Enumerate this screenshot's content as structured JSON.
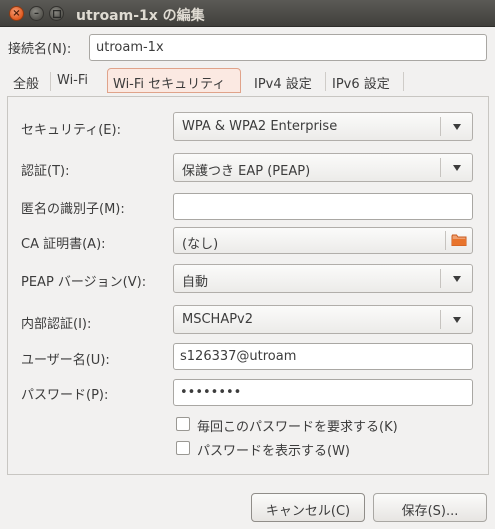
{
  "window": {
    "title": "utroam-1x の編集",
    "close_glyph": "×",
    "min_glyph": "–",
    "max_icon": "maximize-icon"
  },
  "connection": {
    "label": "接続名(N):",
    "value": "utroam-1x"
  },
  "tabs": [
    {
      "label": "全般",
      "active": false
    },
    {
      "label": "Wi-Fi",
      "active": false
    },
    {
      "label": "Wi-Fi セキュリティ",
      "active": true
    },
    {
      "label": "IPv4 設定",
      "active": false
    },
    {
      "label": "IPv6 設定",
      "active": false
    }
  ],
  "security": {
    "label": "セキュリティ(E):",
    "value": "WPA & WPA2 Enterprise"
  },
  "auth": {
    "label": "認証(T):",
    "value": "保護つき EAP (PEAP)"
  },
  "anon_identity": {
    "label": "匿名の識別子(M):",
    "value": ""
  },
  "ca_cert": {
    "label": "CA 証明書(A):",
    "value": "(なし)",
    "icon": "folder-icon"
  },
  "peap_version": {
    "label": "PEAP バージョン(V):",
    "value": "自動"
  },
  "inner_auth": {
    "label": "内部認証(I):",
    "value": "MSCHAPv2"
  },
  "username": {
    "label": "ユーザー名(U):",
    "value": "s126337@utroam"
  },
  "password": {
    "label": "パスワード(P):",
    "value": "••••••••"
  },
  "ask_password": {
    "label": "毎回このパスワードを要求する(K)",
    "checked": false
  },
  "show_password": {
    "label": "パスワードを表示する(W)",
    "checked": false
  },
  "buttons": {
    "cancel": "キャンセル(C)",
    "save": "保存(S)..."
  },
  "colors": {
    "titlebar": "#403f3b",
    "close_button": "#e05a20",
    "active_tab_border": "#e0a38a",
    "folder_icon": "#e8742c"
  }
}
